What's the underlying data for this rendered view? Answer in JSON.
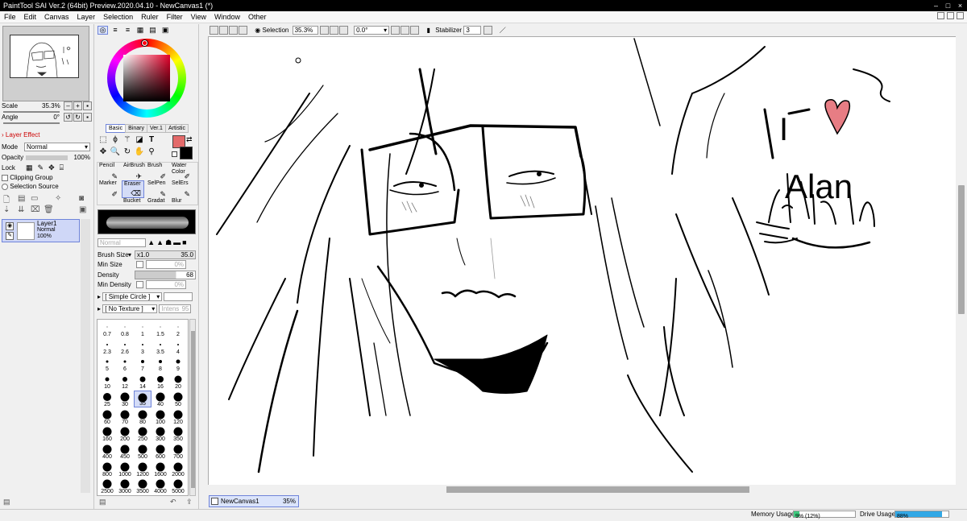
{
  "app": {
    "title": "PaintTool SAI Ver.2 (64bit) Preview.2020.04.10 - NewCanvas1 (*)",
    "window_buttons": [
      "–",
      "□",
      "×"
    ]
  },
  "menu": [
    "File",
    "Edit",
    "Canvas",
    "Layer",
    "Selection",
    "Ruler",
    "Filter",
    "View",
    "Window",
    "Other"
  ],
  "navigator": {
    "scale_label": "Scale",
    "scale_value": "35.3%",
    "angle_label": "Angle",
    "angle_value": "0°"
  },
  "layer_panel": {
    "effect_label": "Layer Effect",
    "mode_label": "Mode",
    "mode_value": "Normal",
    "opacity_label": "Opacity",
    "opacity_value": "100%",
    "lock_label": "Lock",
    "clipping_label": "Clipping Group",
    "selection_source_label": "Selection Source",
    "layer": {
      "name": "Layer1",
      "mode": "Normal",
      "opacity": "100%"
    }
  },
  "color_tabs": [
    "Basic",
    "Binary",
    "Ver.1",
    "Artistic"
  ],
  "colors": {
    "main": "#e36a6a",
    "sub": "#000000",
    "heart": "#e77d84",
    "hue": "#e6002a"
  },
  "tools": [
    {
      "name": "Pencil",
      "selected": false
    },
    {
      "name": "AirBrush",
      "selected": false
    },
    {
      "name": "Brush",
      "selected": false
    },
    {
      "name": "Water Color",
      "selected": false
    },
    {
      "name": "Marker",
      "selected": false
    },
    {
      "name": "Eraser",
      "selected": true
    },
    {
      "name": "SelPen",
      "selected": false
    },
    {
      "name": "SelErs",
      "selected": false
    },
    {
      "name": "Bucket",
      "selected": false
    },
    {
      "name": "Gradat",
      "selected": false
    },
    {
      "name": "Blur",
      "selected": false
    }
  ],
  "brush_settings": {
    "blend_mode": "Normal",
    "size_label": "Brush Size",
    "size_multiplier": "x1.0",
    "size_value": "35.0",
    "min_size_label": "Min Size",
    "min_size_value": "0%",
    "density_label": "Density",
    "density_value": "68",
    "min_density_label": "Min Density",
    "min_density_value": "0%",
    "shape": "[ Simple Circle ]",
    "texture": "[ No Texture ]",
    "texture_intensity_label": "Intens",
    "texture_intensity_value": "95"
  },
  "brush_sizes": [
    {
      "label": "0.7",
      "d": 1
    },
    {
      "label": "0.8",
      "d": 1
    },
    {
      "label": "1",
      "d": 1
    },
    {
      "label": "1.5",
      "d": 1
    },
    {
      "label": "2",
      "d": 1
    },
    {
      "label": "2.3",
      "d": 2
    },
    {
      "label": "2.6",
      "d": 2
    },
    {
      "label": "3",
      "d": 2
    },
    {
      "label": "3.5",
      "d": 2
    },
    {
      "label": "4",
      "d": 2
    },
    {
      "label": "5",
      "d": 3
    },
    {
      "label": "6",
      "d": 3
    },
    {
      "label": "7",
      "d": 4
    },
    {
      "label": "8",
      "d": 4
    },
    {
      "label": "9",
      "d": 5
    },
    {
      "label": "10",
      "d": 5
    },
    {
      "label": "12",
      "d": 6
    },
    {
      "label": "14",
      "d": 7
    },
    {
      "label": "16",
      "d": 8
    },
    {
      "label": "20",
      "d": 9
    },
    {
      "label": "25",
      "d": 10
    },
    {
      "label": "30",
      "d": 11
    },
    {
      "label": "35",
      "d": 11,
      "selected": true
    },
    {
      "label": "40",
      "d": 11
    },
    {
      "label": "50",
      "d": 11
    },
    {
      "label": "60",
      "d": 11
    },
    {
      "label": "70",
      "d": 11
    },
    {
      "label": "80",
      "d": 11
    },
    {
      "label": "100",
      "d": 11
    },
    {
      "label": "120",
      "d": 11
    },
    {
      "label": "160",
      "d": 11
    },
    {
      "label": "200",
      "d": 11
    },
    {
      "label": "250",
      "d": 11
    },
    {
      "label": "300",
      "d": 11
    },
    {
      "label": "350",
      "d": 11
    },
    {
      "label": "400",
      "d": 11
    },
    {
      "label": "450",
      "d": 11
    },
    {
      "label": "500",
      "d": 11
    },
    {
      "label": "600",
      "d": 11
    },
    {
      "label": "700",
      "d": 11
    },
    {
      "label": "800",
      "d": 11
    },
    {
      "label": "1000",
      "d": 11
    },
    {
      "label": "1200",
      "d": 11
    },
    {
      "label": "1600",
      "d": 11
    },
    {
      "label": "2000",
      "d": 11
    },
    {
      "label": "2500",
      "d": 11
    },
    {
      "label": "3000",
      "d": 11
    },
    {
      "label": "3500",
      "d": 11
    },
    {
      "label": "4000",
      "d": 11
    },
    {
      "label": "5000",
      "d": 11
    }
  ],
  "view_toolbar": {
    "selection_label": "Selection",
    "zoom_value": "35.3%",
    "angle_value": "0.0°",
    "stabilizer_label": "Stabilizer",
    "stabilizer_value": "3"
  },
  "canvas_text": {
    "line1": "I",
    "line2": "Alan"
  },
  "document_tab": {
    "name": "NewCanvas1",
    "zoom": "35%"
  },
  "status": {
    "memory_label": "Memory Usage",
    "memory_value": "9% (12%)",
    "memory_fraction": 0.09,
    "drive_label": "Drive Usage",
    "drive_value": "88%",
    "drive_fraction": 0.88
  }
}
